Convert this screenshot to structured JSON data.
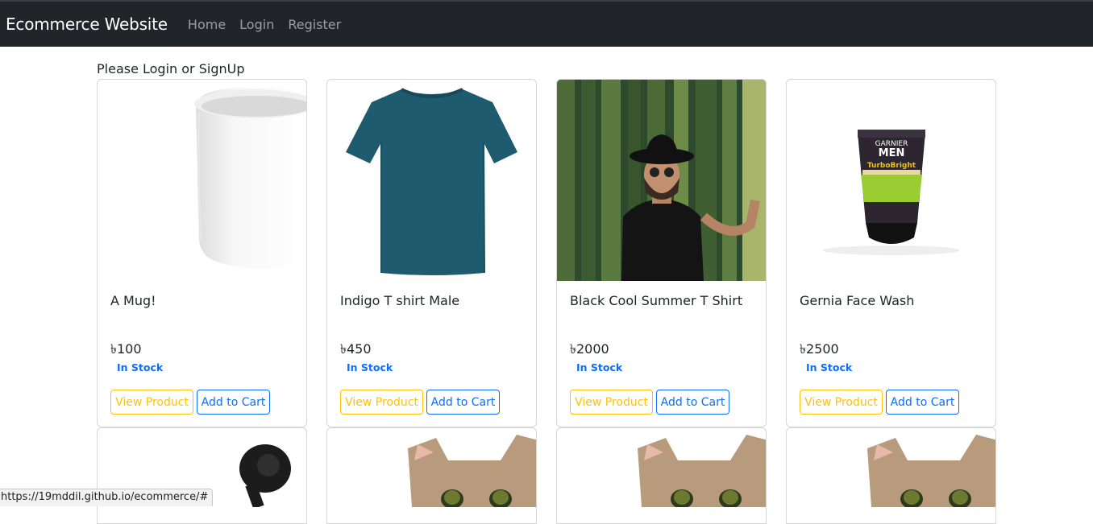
{
  "navbar": {
    "brand": "Ecommerce Website",
    "links": [
      "Home",
      "Login",
      "Register"
    ]
  },
  "prompt": "Please Login or SignUp",
  "products": [
    {
      "title": "A Mug!",
      "price": "৳100",
      "stock": "In Stock",
      "view_label": "View Product",
      "cart_label": "Add to Cart",
      "image": "white-mug"
    },
    {
      "title": "Indigo T shirt Male",
      "price": "৳450",
      "stock": "In Stock",
      "view_label": "View Product",
      "cart_label": "Add to Cart",
      "image": "teal-tshirt"
    },
    {
      "title": "Black Cool Summer T Shirt",
      "price": "৳2000",
      "stock": "In Stock",
      "view_label": "View Product",
      "cart_label": "Add to Cart",
      "image": "man-in-bamboo-forest"
    },
    {
      "title": "Gernia Face Wash",
      "price": "৳2500",
      "stock": "In Stock",
      "view_label": "View Product",
      "cart_label": "Add to Cart",
      "image": "garnier-men-face-wash"
    }
  ],
  "second_row_images": [
    "black-earbud",
    "cat-face",
    "cat-face",
    "cat-face"
  ],
  "mug_brand": {
    "logo_line1": "GARNIER",
    "logo_line2": "MEN",
    "product": "TurboBright",
    "sub": "BRIGHTENING FACE WASH"
  },
  "status_bar": "https://19mddil.github.io/ecommerce/#",
  "colors": {
    "navbar": "#212529",
    "view_button": "#ffc107",
    "cart_button": "#0d6efd",
    "stock": "#0d6efd"
  }
}
